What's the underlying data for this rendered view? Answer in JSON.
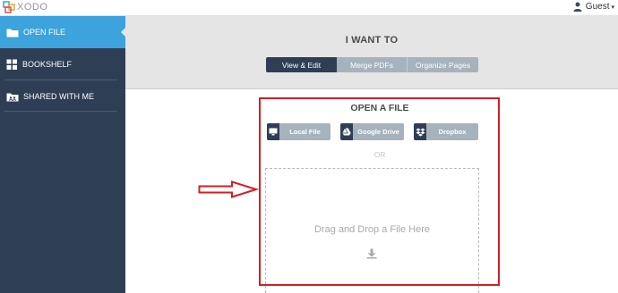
{
  "app": {
    "brand": "XODO"
  },
  "user": {
    "name": "Guest"
  },
  "sidebar": {
    "items": [
      {
        "label": "OPEN FILE",
        "icon": "folder-icon",
        "active": true
      },
      {
        "label": "BOOKSHELF",
        "icon": "grid-icon",
        "active": false
      },
      {
        "label": "SHARED WITH ME",
        "icon": "shared-folder-icon",
        "active": false
      }
    ]
  },
  "header": {
    "title": "I WANT TO",
    "tabs": [
      {
        "label": "View & Edit",
        "active": true
      },
      {
        "label": "Merge PDFs",
        "active": false
      },
      {
        "label": "Organize Pages",
        "active": false
      }
    ]
  },
  "open_file": {
    "title": "OPEN A FILE",
    "sources": [
      {
        "label": "Local File",
        "icon": "monitor-icon"
      },
      {
        "label": "Google Drive",
        "icon": "google-drive-icon"
      },
      {
        "label": "Dropbox",
        "icon": "dropbox-icon"
      }
    ],
    "or_text": "OR",
    "drop_text": "Drag and Drop a File Here",
    "drop_icon": "download-icon"
  },
  "colors": {
    "sidebar_bg": "#2e3e55",
    "sidebar_active": "#3ca3dd",
    "band_bg": "#e5e5e5",
    "button_gray": "#a6b3bd",
    "annotation_red": "#d21f26"
  }
}
